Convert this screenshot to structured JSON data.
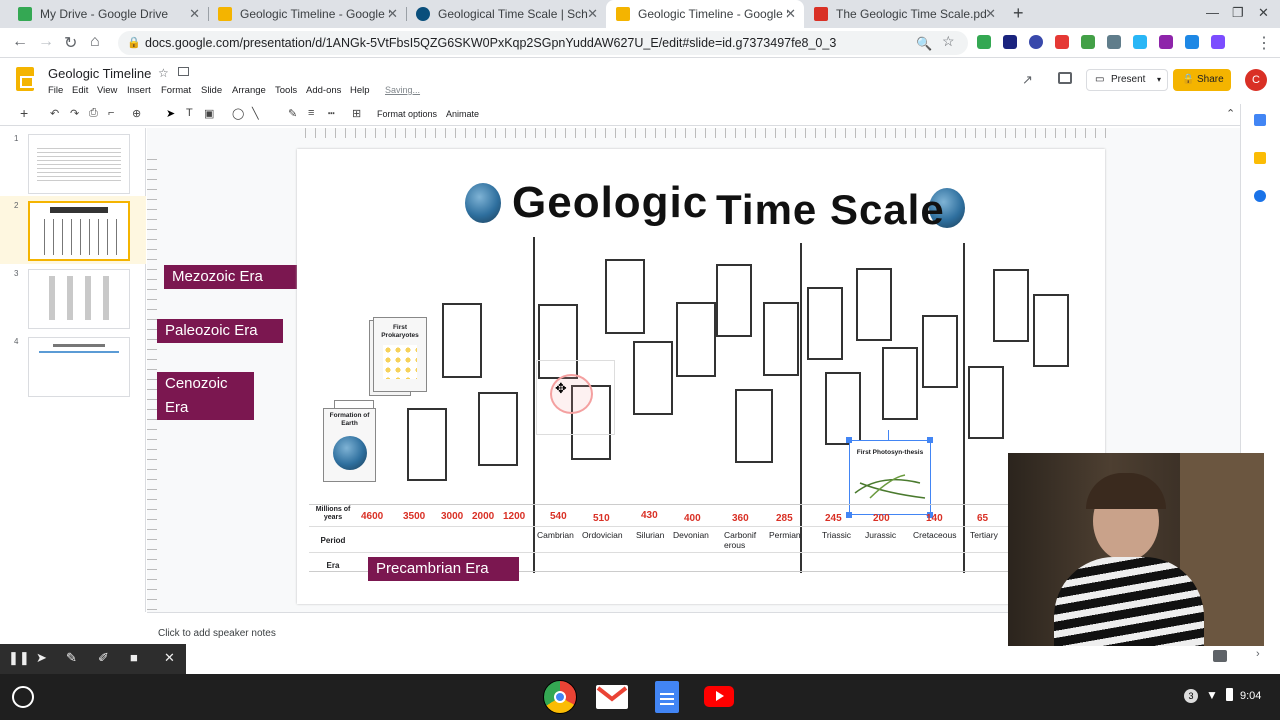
{
  "browser": {
    "tabs": [
      {
        "title": "My Drive - Google Drive",
        "icon": "drive-icon",
        "color": "#34a853"
      },
      {
        "title": "Geologic Timeline - Google Slides",
        "icon": "slides-icon",
        "color": "#f4b400"
      },
      {
        "title": "Geological Time Scale | Schoology",
        "icon": "schoology-icon",
        "color": "#0a4f7c"
      },
      {
        "title": "Geologic Timeline - Google Slides",
        "icon": "slides-icon",
        "color": "#f4b400"
      },
      {
        "title": "The Geologic Time Scale.pdf - Google Drive",
        "icon": "pdf-icon",
        "color": "#d93025"
      }
    ],
    "url": "docs.google.com/presentation/d/1ANGk-5VtFbsI5QZG6SKW0PxKqp2SGpnYuddAW627U_E/edit#slide=id.g7373497fe8_0_3"
  },
  "docs": {
    "title": "Geologic Timeline",
    "menus": [
      "File",
      "Edit",
      "View",
      "Insert",
      "Format",
      "Slide",
      "Arrange",
      "Tools",
      "Add-ons",
      "Help"
    ],
    "saving": "Saving...",
    "present": "Present",
    "share": "Share",
    "avatar_letter": "C",
    "toolbar_format": "Format options",
    "toolbar_animate": "Animate",
    "speaker_notes": "Click to add speaker notes"
  },
  "filmstrip": {
    "numbers": [
      "1",
      "2",
      "3",
      "4"
    ]
  },
  "slide": {
    "title_word1": "Geologic",
    "title_word2": "Time Scale",
    "eras": {
      "mezozoic": "Mezozoic Era",
      "paleozoic": "Paleozoic Era",
      "cenozoic": "Cenozoic  Era",
      "precambrian": "Precambrian Era"
    },
    "cards": {
      "first_prokaryotes": "First Prokaryotes",
      "formation_of_earth": "Formation of Earth",
      "first_photosynthesis": "First Photosyn-thesis"
    },
    "table": {
      "row_label_years": "Millions of years",
      "row_label_period": "Period",
      "row_label_era": "Era",
      "years": [
        "4600",
        "3500",
        "3000",
        "2000",
        "1200",
        "540",
        "510",
        "430",
        "400",
        "360",
        "285",
        "245",
        "200",
        "140",
        "65"
      ],
      "periods": [
        "Cambrian",
        "Ordovician",
        "Silurian",
        "Devonian",
        "Carbonif erous",
        "Permian",
        "Triassic",
        "Jurassic",
        "Cretaceous",
        "Tertiary"
      ]
    }
  },
  "system": {
    "clock": "9:04",
    "notif_count": "3"
  }
}
